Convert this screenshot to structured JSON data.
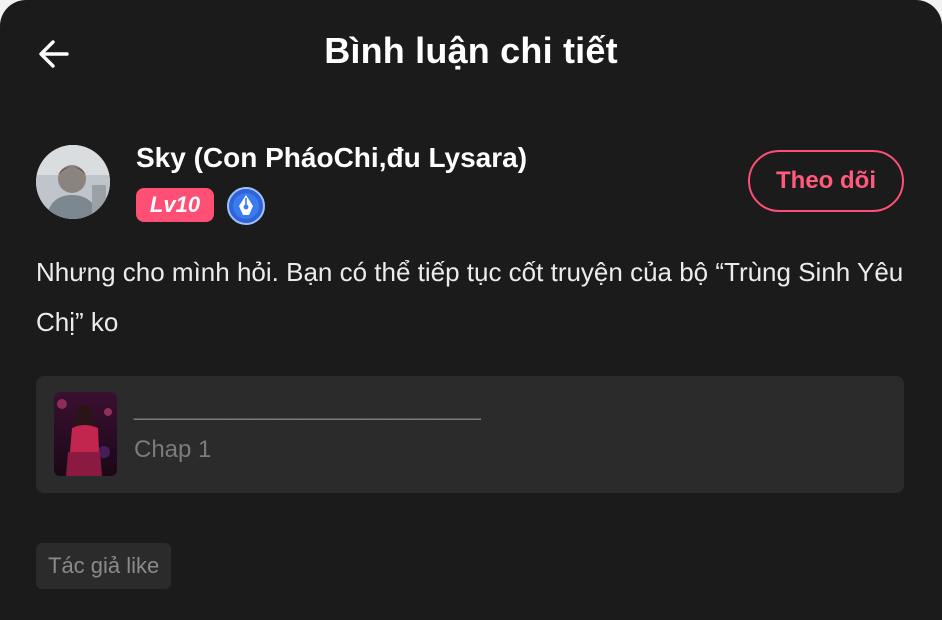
{
  "header": {
    "title": "Bình luận chi tiết",
    "back_icon": "arrow-left-icon"
  },
  "comment": {
    "author": "Sky (Con PháoChi,đu Lysara)",
    "level": "Lv10",
    "badge_icon": "pen-nib-icon",
    "follow_label": "Theo dõi",
    "text": "Nhưng cho mình hỏi. Bạn có thể tiếp tục cốt truyện của bộ “Trùng Sinh Yêu Chị” ko"
  },
  "story": {
    "title": "____________________________",
    "chapter": "Chap 1"
  },
  "tags": {
    "author_like": "Tác giả like"
  },
  "colors": {
    "accent": "#ff4f74",
    "background": "#1b1b1c",
    "card": "#2b2b2c"
  }
}
